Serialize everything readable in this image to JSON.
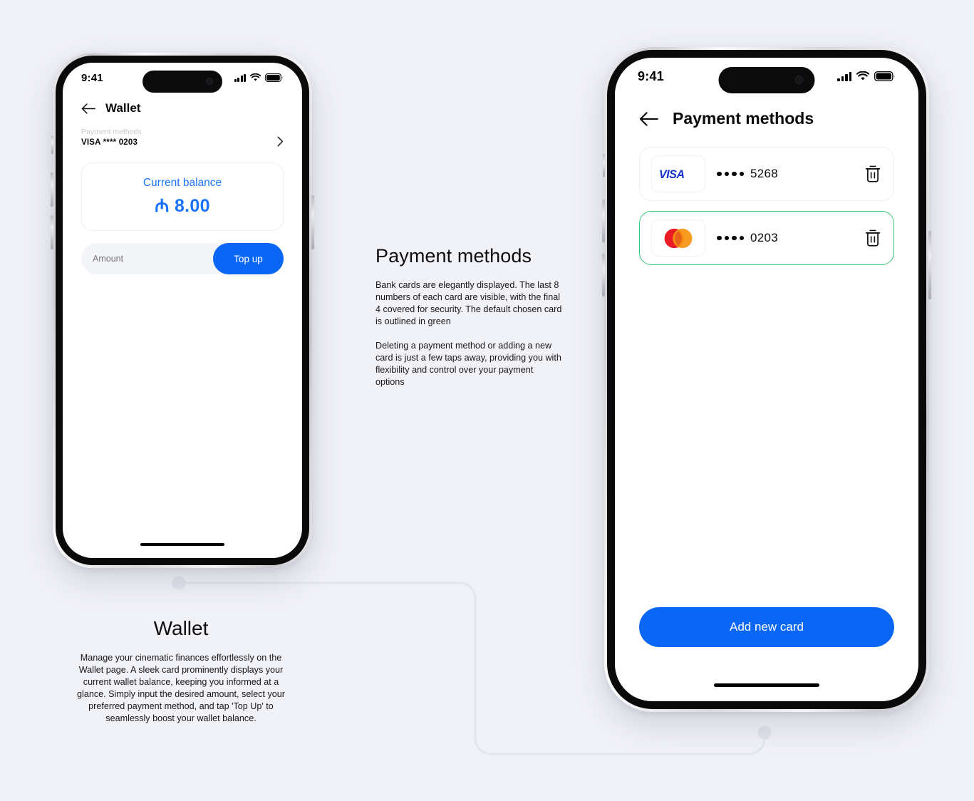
{
  "background_color": "#f1f2f8",
  "accent_blue": "#0a66f5",
  "selected_green": "#34c878",
  "phone_left": {
    "status_bar": {
      "time": "9:41",
      "signal_icon": "cellular-bars-icon",
      "wifi_icon": "wifi-icon",
      "battery_icon": "battery-full-icon"
    },
    "nav": {
      "back_icon": "arrow-left-icon",
      "title": "Wallet"
    },
    "payment_method_row": {
      "label": "Payment methods",
      "value": "VISA **** 0203",
      "chevron_icon": "chevron-right-icon"
    },
    "balance_card": {
      "label": "Current balance",
      "amount": "₼ 8.00"
    },
    "amount_field": {
      "placeholder": "Amount",
      "value": ""
    },
    "topup_button": {
      "label": "Top up"
    }
  },
  "phone_right": {
    "status_bar": {
      "time": "9:41",
      "signal_icon": "cellular-bars-icon",
      "wifi_icon": "wifi-icon",
      "battery_icon": "battery-full-icon"
    },
    "nav": {
      "back_icon": "arrow-left-icon",
      "title": "Payment methods"
    },
    "cards": [
      {
        "brand": "VISA",
        "brand_icon": "visa-logo-icon",
        "masked": "••••",
        "last4": "5268",
        "selected": false,
        "delete_icon": "trash-icon"
      },
      {
        "brand": "Mastercard",
        "brand_icon": "mastercard-logo-icon",
        "masked": "••••",
        "last4": "0203",
        "selected": true,
        "delete_icon": "trash-icon"
      }
    ],
    "add_card_button": {
      "label": "Add new card"
    }
  },
  "copy_payment_methods": {
    "heading": "Payment methods",
    "paragraph_1": "Bank cards are elegantly displayed. The last 8 numbers of each card are visible, with the final 4 covered for security. The default chosen card is outlined in green",
    "paragraph_2": "Deleting a payment method or adding a new card is just a few taps away, providing you with flexibility and control over your payment options"
  },
  "copy_wallet": {
    "heading": "Wallet",
    "paragraph_1": "Manage your cinematic finances effortlessly on the Wallet page. A sleek card prominently displays your current wallet balance, keeping you informed at a glance. Simply input the desired amount, select your preferred payment method, and tap 'Top Up' to seamlessly boost your wallet balance."
  }
}
